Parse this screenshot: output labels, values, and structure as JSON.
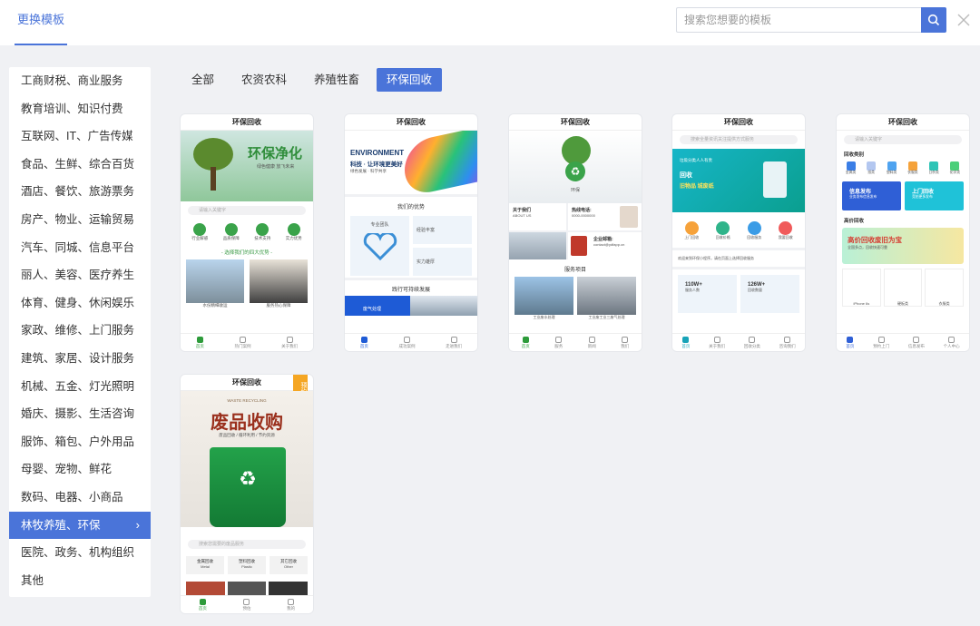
{
  "header": {
    "tab_label": "更换模板",
    "search_placeholder": "搜索您想要的模板"
  },
  "sidebar": {
    "items": [
      {
        "label": "工商财税、商业服务"
      },
      {
        "label": "教育培训、知识付费"
      },
      {
        "label": "互联网、IT、广告传媒"
      },
      {
        "label": "食品、生鲜、综合百货"
      },
      {
        "label": "酒店、餐饮、旅游票务"
      },
      {
        "label": "房产、物业、运输贸易"
      },
      {
        "label": "汽车、同城、信息平台"
      },
      {
        "label": "丽人、美容、医疗养生"
      },
      {
        "label": "体育、健身、休闲娱乐"
      },
      {
        "label": "家政、维修、上门服务"
      },
      {
        "label": "建筑、家居、设计服务"
      },
      {
        "label": "机械、五金、灯光照明"
      },
      {
        "label": "婚庆、摄影、生活咨询"
      },
      {
        "label": "服饰、箱包、户外用品"
      },
      {
        "label": "母婴、宠物、鲜花"
      },
      {
        "label": "数码、电器、小商品"
      },
      {
        "label": "林牧养殖、环保"
      },
      {
        "label": "医院、政务、机构组织"
      },
      {
        "label": "其他"
      }
    ],
    "active_index": 16,
    "chevron": "›"
  },
  "filters": [
    {
      "label": "全部"
    },
    {
      "label": "农资农科"
    },
    {
      "label": "养殖牲畜"
    },
    {
      "label": "环保回收"
    }
  ],
  "active_filter": 3,
  "colors": {
    "accent": "#4a74d9",
    "green": "#2d9b3a"
  },
  "cards": [
    {
      "title": "环保回收",
      "hero": "环保净化",
      "hero_sub": "绿色健康 放飞未来",
      "search": "请输入关键字",
      "icons": [
        "行业解惑",
        "品质保障",
        "技术支持",
        "实力优势"
      ],
      "section": "- 选择我们的四大优势 -",
      "caps": [
        "水份精细收运",
        "服务热心保障"
      ],
      "tabs": [
        "首页",
        "热门案例",
        "关于我们"
      ]
    },
    {
      "title": "环保回收",
      "banner1": "ENVIRONMENT",
      "banner2": "科技 · 让环境更美好",
      "banner3": "绿色发展 · 科学共享",
      "sec1": "我们的优势",
      "tiles": [
        "专业团队",
        "经验丰富",
        "实力雄厚"
      ],
      "sec2": "践行可持续发展",
      "bar": "废气处理",
      "tabs": [
        "首页",
        "成功案例",
        "走进我们"
      ]
    },
    {
      "title": "环保回收",
      "hero_text": "环保",
      "about": "关于我们",
      "about_sub": "ABOUT US",
      "tel": "热线电话:",
      "tel_num": "0000-0000000",
      "mail": "企业邮箱:",
      "mail_addr": "contact@ydfapp.cn",
      "sec": "服务项目",
      "caps": [
        "工业废水处理",
        "工业废工业三废气处理"
      ],
      "tabs": [
        "首页",
        "服务",
        "新闻",
        "我们"
      ]
    },
    {
      "title": "环保回收",
      "search": "搜索全量资讯关注提供方式服务",
      "b1": "垃圾分类人人有责",
      "b2": "回收",
      "b3": "旧物品 城废纸",
      "icons": [
        "上门回收",
        "回收价格",
        "回收服务",
        "我要回收"
      ],
      "notice": "欢迎来到环保小程序，请在页面上选择回收服务",
      "n1": "110W+",
      "n1s": "服务人数",
      "n2": "126W+",
      "n2s": "回收数量",
      "tabs": [
        "首页",
        "关于我们",
        "回收分类",
        "咨询我们"
      ]
    },
    {
      "title": "环保回收",
      "search": "请输入关键字",
      "sec1": "回收类别",
      "cats": [
        "金属类",
        "纸类",
        "塑料类",
        "衣服类",
        "日杂类",
        "化学类"
      ],
      "b1": "信息发布",
      "b1s": "业务发布信息发布",
      "b2": "上门回收",
      "b2s": "竞拍更多发布",
      "sec2": "高价回收",
      "banner": "高价回收废旧为宝",
      "banner_sub": "全国多点，回收快速可靠",
      "items": [
        "iPhone 6s",
        "硬板类",
        "衣服类"
      ],
      "tabs": [
        "首页",
        "预约上门",
        "信息发布",
        "个人中心"
      ]
    },
    {
      "title": "环保回收",
      "tag": "预约",
      "en": "WASTE RECYCLING",
      "hero": "废品收购",
      "hero_sub": "废品回收 / 循环利用 / 节约资源",
      "search": "搜索您需要的废品服务",
      "cats": [
        {
          "cn": "金属回收",
          "en": "Metal"
        },
        {
          "cn": "塑料回收",
          "en": "Plastic"
        },
        {
          "cn": "其它回收",
          "en": "Other"
        }
      ],
      "tabs": [
        "首页",
        "预估",
        "我的"
      ]
    }
  ]
}
